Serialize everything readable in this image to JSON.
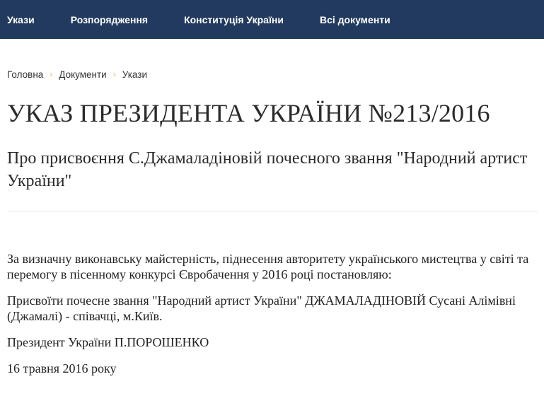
{
  "nav": {
    "items": [
      {
        "label": "Укази"
      },
      {
        "label": "Розпорядження"
      },
      {
        "label": "Конституція України"
      },
      {
        "label": "Всі документи"
      }
    ]
  },
  "breadcrumb": {
    "home": "Головна",
    "documents": "Документи",
    "current": "Укази",
    "separator": "›"
  },
  "document": {
    "title": "УКАЗ ПРЕЗИДЕНТА УКРАЇНИ №213/2016",
    "subtitle": "Про присвоєння С.Джамаладіновій почесного звання \"Народний артист України\"",
    "paragraphs": [
      "За визначну виконавську майстерність, піднесення авторитету українського мистецтва у світі та перемогу в пісенному конкурсі Євробачення у 2016 році постановляю:",
      "Присвоїти почесне звання \"Народний артист України\" ДЖАМАЛАДІНОВІЙ Сусані Алімівні (Джамалі) - співачці, м.Київ."
    ],
    "signature": "Президент України П.ПОРОШЕНКО",
    "date": "16 травня 2016 року"
  },
  "colors": {
    "nav_bg": "#223a5e",
    "breadcrumb_separator": "#e0b25a"
  }
}
